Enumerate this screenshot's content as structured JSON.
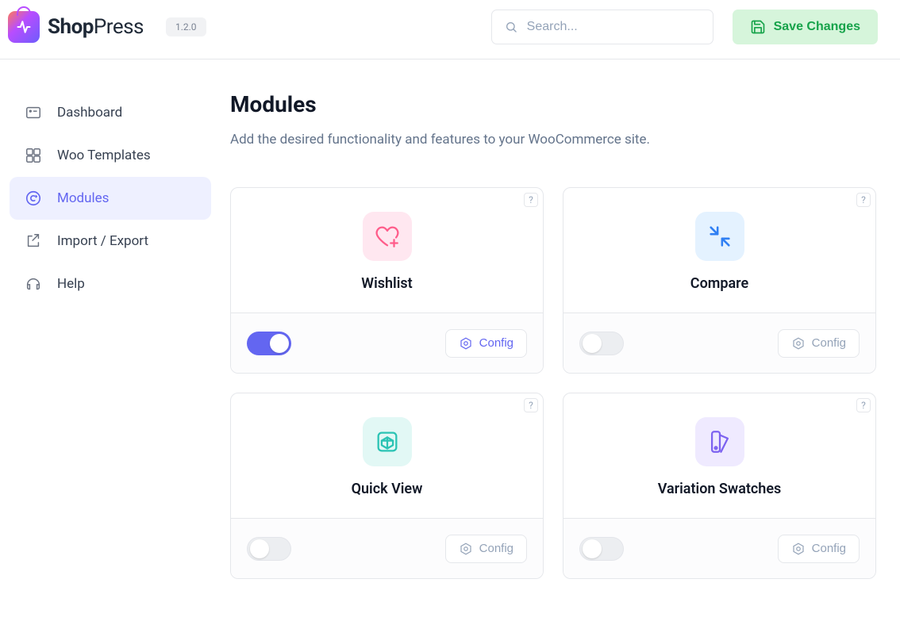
{
  "header": {
    "brand_shop": "Shop",
    "brand_press": "Press",
    "version": "1.2.0",
    "search_placeholder": "Search...",
    "save_label": "Save Changes"
  },
  "sidebar": {
    "items": [
      {
        "label": "Dashboard"
      },
      {
        "label": "Woo Templates"
      },
      {
        "label": "Modules"
      },
      {
        "label": "Import / Export"
      },
      {
        "label": "Help"
      }
    ],
    "active_index": 2
  },
  "page": {
    "title": "Modules",
    "subtitle": "Add the desired functionality and features to your WooCommerce site."
  },
  "modules": {
    "config_label": "Config",
    "help_symbol": "?",
    "items": [
      {
        "title": "Wishlist",
        "enabled": true
      },
      {
        "title": "Compare",
        "enabled": false
      },
      {
        "title": "Quick View",
        "enabled": false
      },
      {
        "title": "Variation Swatches",
        "enabled": false
      }
    ]
  }
}
